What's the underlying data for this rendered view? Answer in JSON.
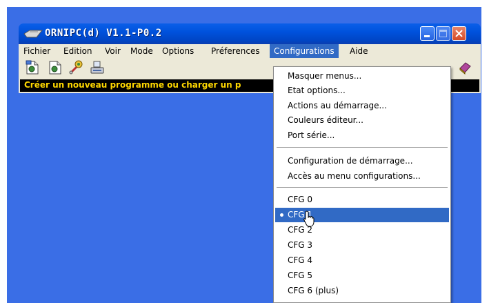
{
  "window": {
    "title": "ORNIPC(d)  V1.1-P0.2"
  },
  "menubar": {
    "items": [
      "Fichier",
      "Edition",
      "Voir",
      "Mode",
      "Options",
      "Préferences",
      "Configurations",
      "Aide"
    ]
  },
  "toolbar": {
    "buttons": [
      "new-program-icon",
      "open-program-icon",
      "transfer-icon",
      "port-icon",
      "help-book-icon"
    ]
  },
  "status": {
    "text": "Créer un nouveau programme ou charger un p"
  },
  "configurations_menu": {
    "group1": [
      "Masquer menus...",
      "Etat options...",
      "Actions au démarrage...",
      "Couleurs éditeur...",
      "Port série..."
    ],
    "group2": [
      "Configuration de démarrage...",
      "Accès au menu configurations..."
    ],
    "group3": [
      "CFG 0",
      "CFG 1",
      "CFG 2",
      "CFG 3",
      "CFG 4",
      "CFG 5",
      "CFG 6 (plus)"
    ],
    "selected": "CFG 1"
  },
  "colors": {
    "titlebar": "#0052dd",
    "menu_highlight": "#316ac5",
    "status_text": "#ffd800",
    "desktop": "#3a6ee6"
  }
}
